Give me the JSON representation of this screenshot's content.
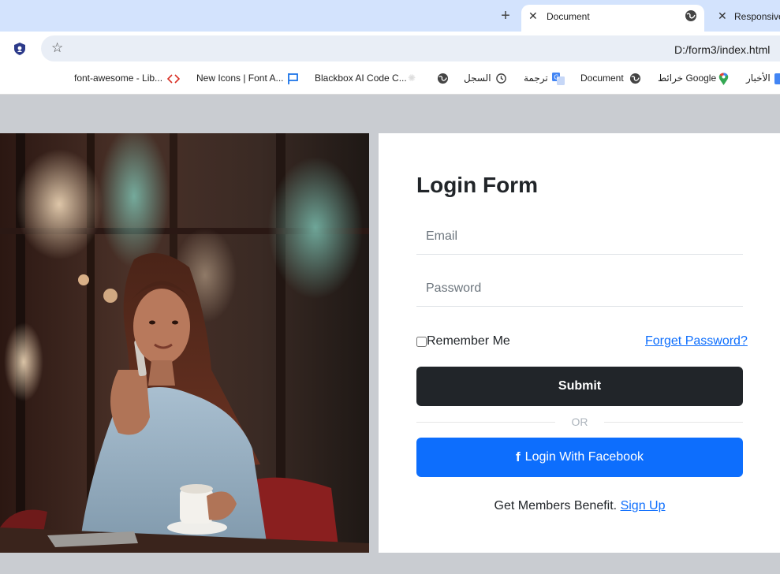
{
  "browser": {
    "tabs": [
      {
        "title": "Document",
        "close": "✕",
        "icon": "globe-icon",
        "active": true
      },
      {
        "title": "Responsive",
        "close": "✕",
        "active": false
      }
    ],
    "new_tab": "+",
    "url": "D:/form3/index.html",
    "bookmarks": [
      {
        "label": "font-awesome - Lib...",
        "icon": "code-icon"
      },
      {
        "label": "New Icons | Font A...",
        "icon": "flag-icon"
      },
      {
        "label": "Blackbox AI Code C...",
        "icon": "sparkle-icon"
      },
      {
        "label": "",
        "icon": "globe-icon"
      },
      {
        "label": "السجل",
        "icon": "history-icon"
      },
      {
        "label": "ترجمة",
        "icon": "translate-icon"
      },
      {
        "label": "Document",
        "icon": "globe-icon"
      },
      {
        "label": "خرائط Google",
        "icon": "maps-pin-icon"
      },
      {
        "label": "الأخبار",
        "icon": "news-icon"
      }
    ]
  },
  "form": {
    "title": "Login Form",
    "email_placeholder": "Email",
    "password_placeholder": "Password",
    "remember_label": "Remember Me",
    "forgot_label": "Forget Password?",
    "submit_label": "Submit",
    "or_label": "OR",
    "facebook_icon": "f",
    "facebook_label": "Login With Facebook",
    "members_text": "Get Members Benefit.",
    "signup_label": "Sign Up"
  },
  "colors": {
    "tabbar": "#d3e3fd",
    "page_bg": "#c9ccd1",
    "dark_button": "#212529",
    "facebook_button": "#0d6efd",
    "link": "#0d6efd"
  }
}
